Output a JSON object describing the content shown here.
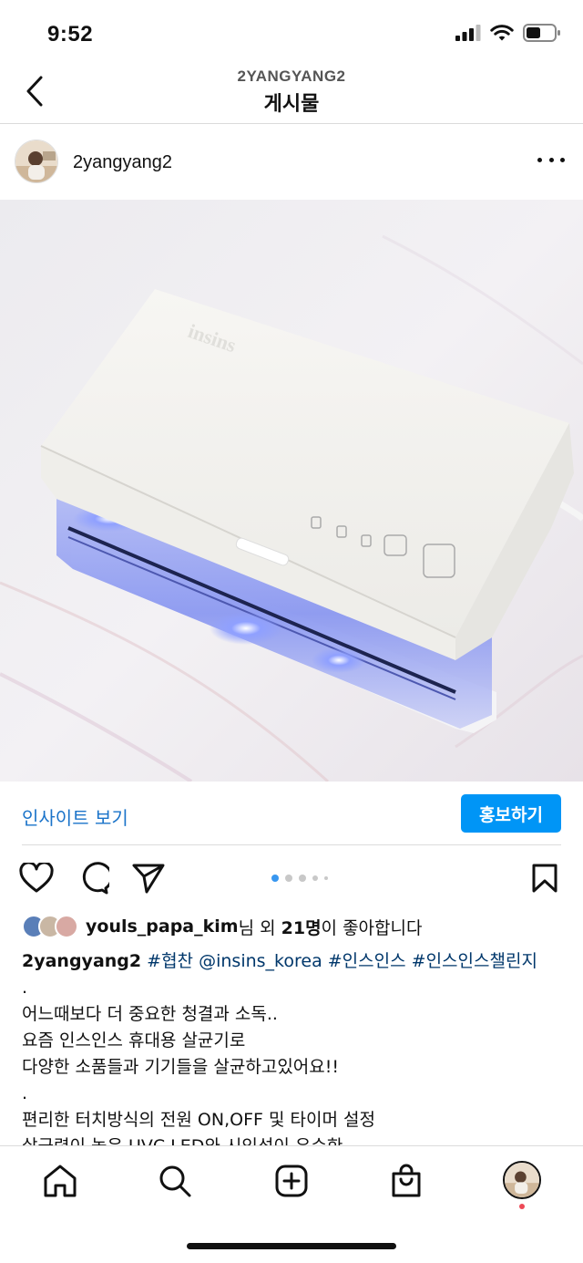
{
  "status_bar": {
    "time": "9:52"
  },
  "header": {
    "username_caps": "2YANGYANG2",
    "title": "게시물"
  },
  "post": {
    "owner": "2yangyang2",
    "insights_label": "인사이트 보기",
    "promote_label": "홍보하기",
    "carousel": {
      "count": 5,
      "active": 1
    }
  },
  "likes": {
    "user": "youls_papa_kim",
    "suffix_1": "님 외 ",
    "count": "21명",
    "suffix_2": "이 좋아합니다"
  },
  "caption": {
    "user": "2yangyang2",
    "tags": [
      "#협찬",
      "@insins_korea",
      "#인스인스",
      "#인스인스챌린지"
    ],
    "lines": [
      ".",
      "어느때보다 더 중요한 청결과 소독..",
      "요즘 인스인스 휴대용 살균기로",
      "다양한 소품들과 기기들을 살균하고있어요!!",
      ".",
      "편리한 터치방식의 전원 ON,OFF 및 타이머 설정",
      "살균력이 높은 UVC LED와 시인성이 우수한"
    ]
  },
  "product_label": "insins",
  "icons": {
    "back": "chevron-left-icon",
    "more": "more-dots-icon",
    "like": "heart-icon",
    "comment": "comment-icon",
    "share": "send-icon",
    "save": "bookmark-icon",
    "home": "home-icon",
    "search": "search-icon",
    "create": "plus-square-icon",
    "shop": "shopping-bag-icon"
  }
}
